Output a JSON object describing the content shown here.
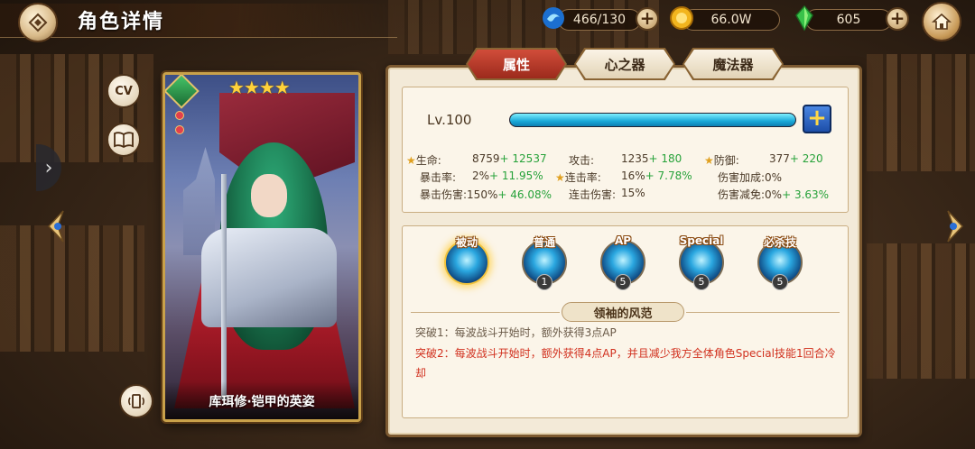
{
  "header": {
    "title": "角色详情"
  },
  "resources": {
    "stamina": {
      "value": "466/130",
      "icon": "water-drop-icon"
    },
    "gold": {
      "value": "66.0W",
      "icon": "gold-coin-icon"
    },
    "gem": {
      "value": "605",
      "icon": "green-crystal-icon"
    }
  },
  "side": {
    "cv_label": "CV"
  },
  "card": {
    "name": "库珥修·铠甲的英姿",
    "stars": "★★★★"
  },
  "tabs": [
    {
      "label": "属性",
      "active": true
    },
    {
      "label": "心之器",
      "active": false
    },
    {
      "label": "魔法器",
      "active": false
    }
  ],
  "level": {
    "label": "Lv.100",
    "progress": 1.0,
    "plus": "+"
  },
  "stats": {
    "hp": {
      "label": "生命:",
      "value": "8759",
      "bonus": "+ 12537"
    },
    "atk": {
      "label": "攻击:",
      "value": "1235",
      "bonus": "+ 180"
    },
    "def": {
      "label": "防御:",
      "value": "377",
      "bonus": "+ 220"
    },
    "crit": {
      "label": "暴击率:",
      "value": "2%",
      "bonus": "+ 11.95%"
    },
    "combo": {
      "label": "连击率:",
      "value": "16%",
      "bonus": "+ 7.78%"
    },
    "dmg_up": {
      "label": "伤害加成:",
      "value": "0%",
      "bonus": ""
    },
    "crit_dmg": {
      "label": "暴击伤害:",
      "value": "150%",
      "bonus": "+ 46.08%"
    },
    "combo_dmg": {
      "label": "连击伤害:",
      "value": "15%",
      "bonus": ""
    },
    "dmg_down": {
      "label": "伤害减免:",
      "value": "0%",
      "bonus": "+ 3.63%"
    }
  },
  "skills": [
    {
      "label": "被动",
      "level": ""
    },
    {
      "label": "普通",
      "level": "1"
    },
    {
      "label": "AP",
      "level": "5"
    },
    {
      "label": "Special",
      "level": "5"
    },
    {
      "label": "必杀技",
      "level": "5"
    }
  ],
  "skill_detail": {
    "name": "领袖的风范",
    "break1": "突破1：每波战斗开始时，额外获得3点AP",
    "break2": "突破2：每波战斗开始时，额外获得4点AP，并且减少我方全体角色Special技能1回合冷却"
  }
}
